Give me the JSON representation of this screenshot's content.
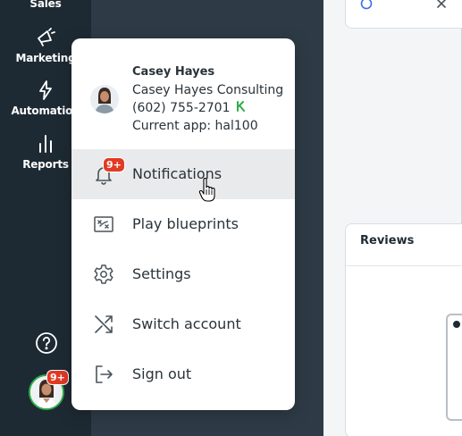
{
  "sidebar": {
    "items": [
      {
        "label": "Sales",
        "icon": "sales-icon"
      },
      {
        "label": "Marketing",
        "icon": "megaphone-icon"
      },
      {
        "label": "Automation",
        "icon": "lightning-icon"
      },
      {
        "label": "Reports",
        "icon": "bar-chart-icon"
      }
    ],
    "help_icon": "help-circle-icon",
    "avatar_badge": "9+"
  },
  "menu": {
    "profile": {
      "name": "Casey Hayes",
      "company": "Casey Hayes Consulting",
      "phone": "(602) 755-2701",
      "current_app": "Current app: hal100"
    },
    "items": [
      {
        "label": "Notifications",
        "icon": "bell-icon",
        "badge": "9+"
      },
      {
        "label": "Play blueprints",
        "icon": "blueprint-icon"
      },
      {
        "label": "Settings",
        "icon": "gear-icon"
      },
      {
        "label": "Switch account",
        "icon": "shuffle-icon"
      },
      {
        "label": "Sign out",
        "icon": "sign-out-icon"
      }
    ]
  },
  "content": {
    "reviews_title": "Reviews"
  },
  "colors": {
    "sidebar": "#1e2a33",
    "badge": "#e23a24",
    "avatar_ring": "#2fae4a",
    "hover": "#e9eaeb"
  }
}
